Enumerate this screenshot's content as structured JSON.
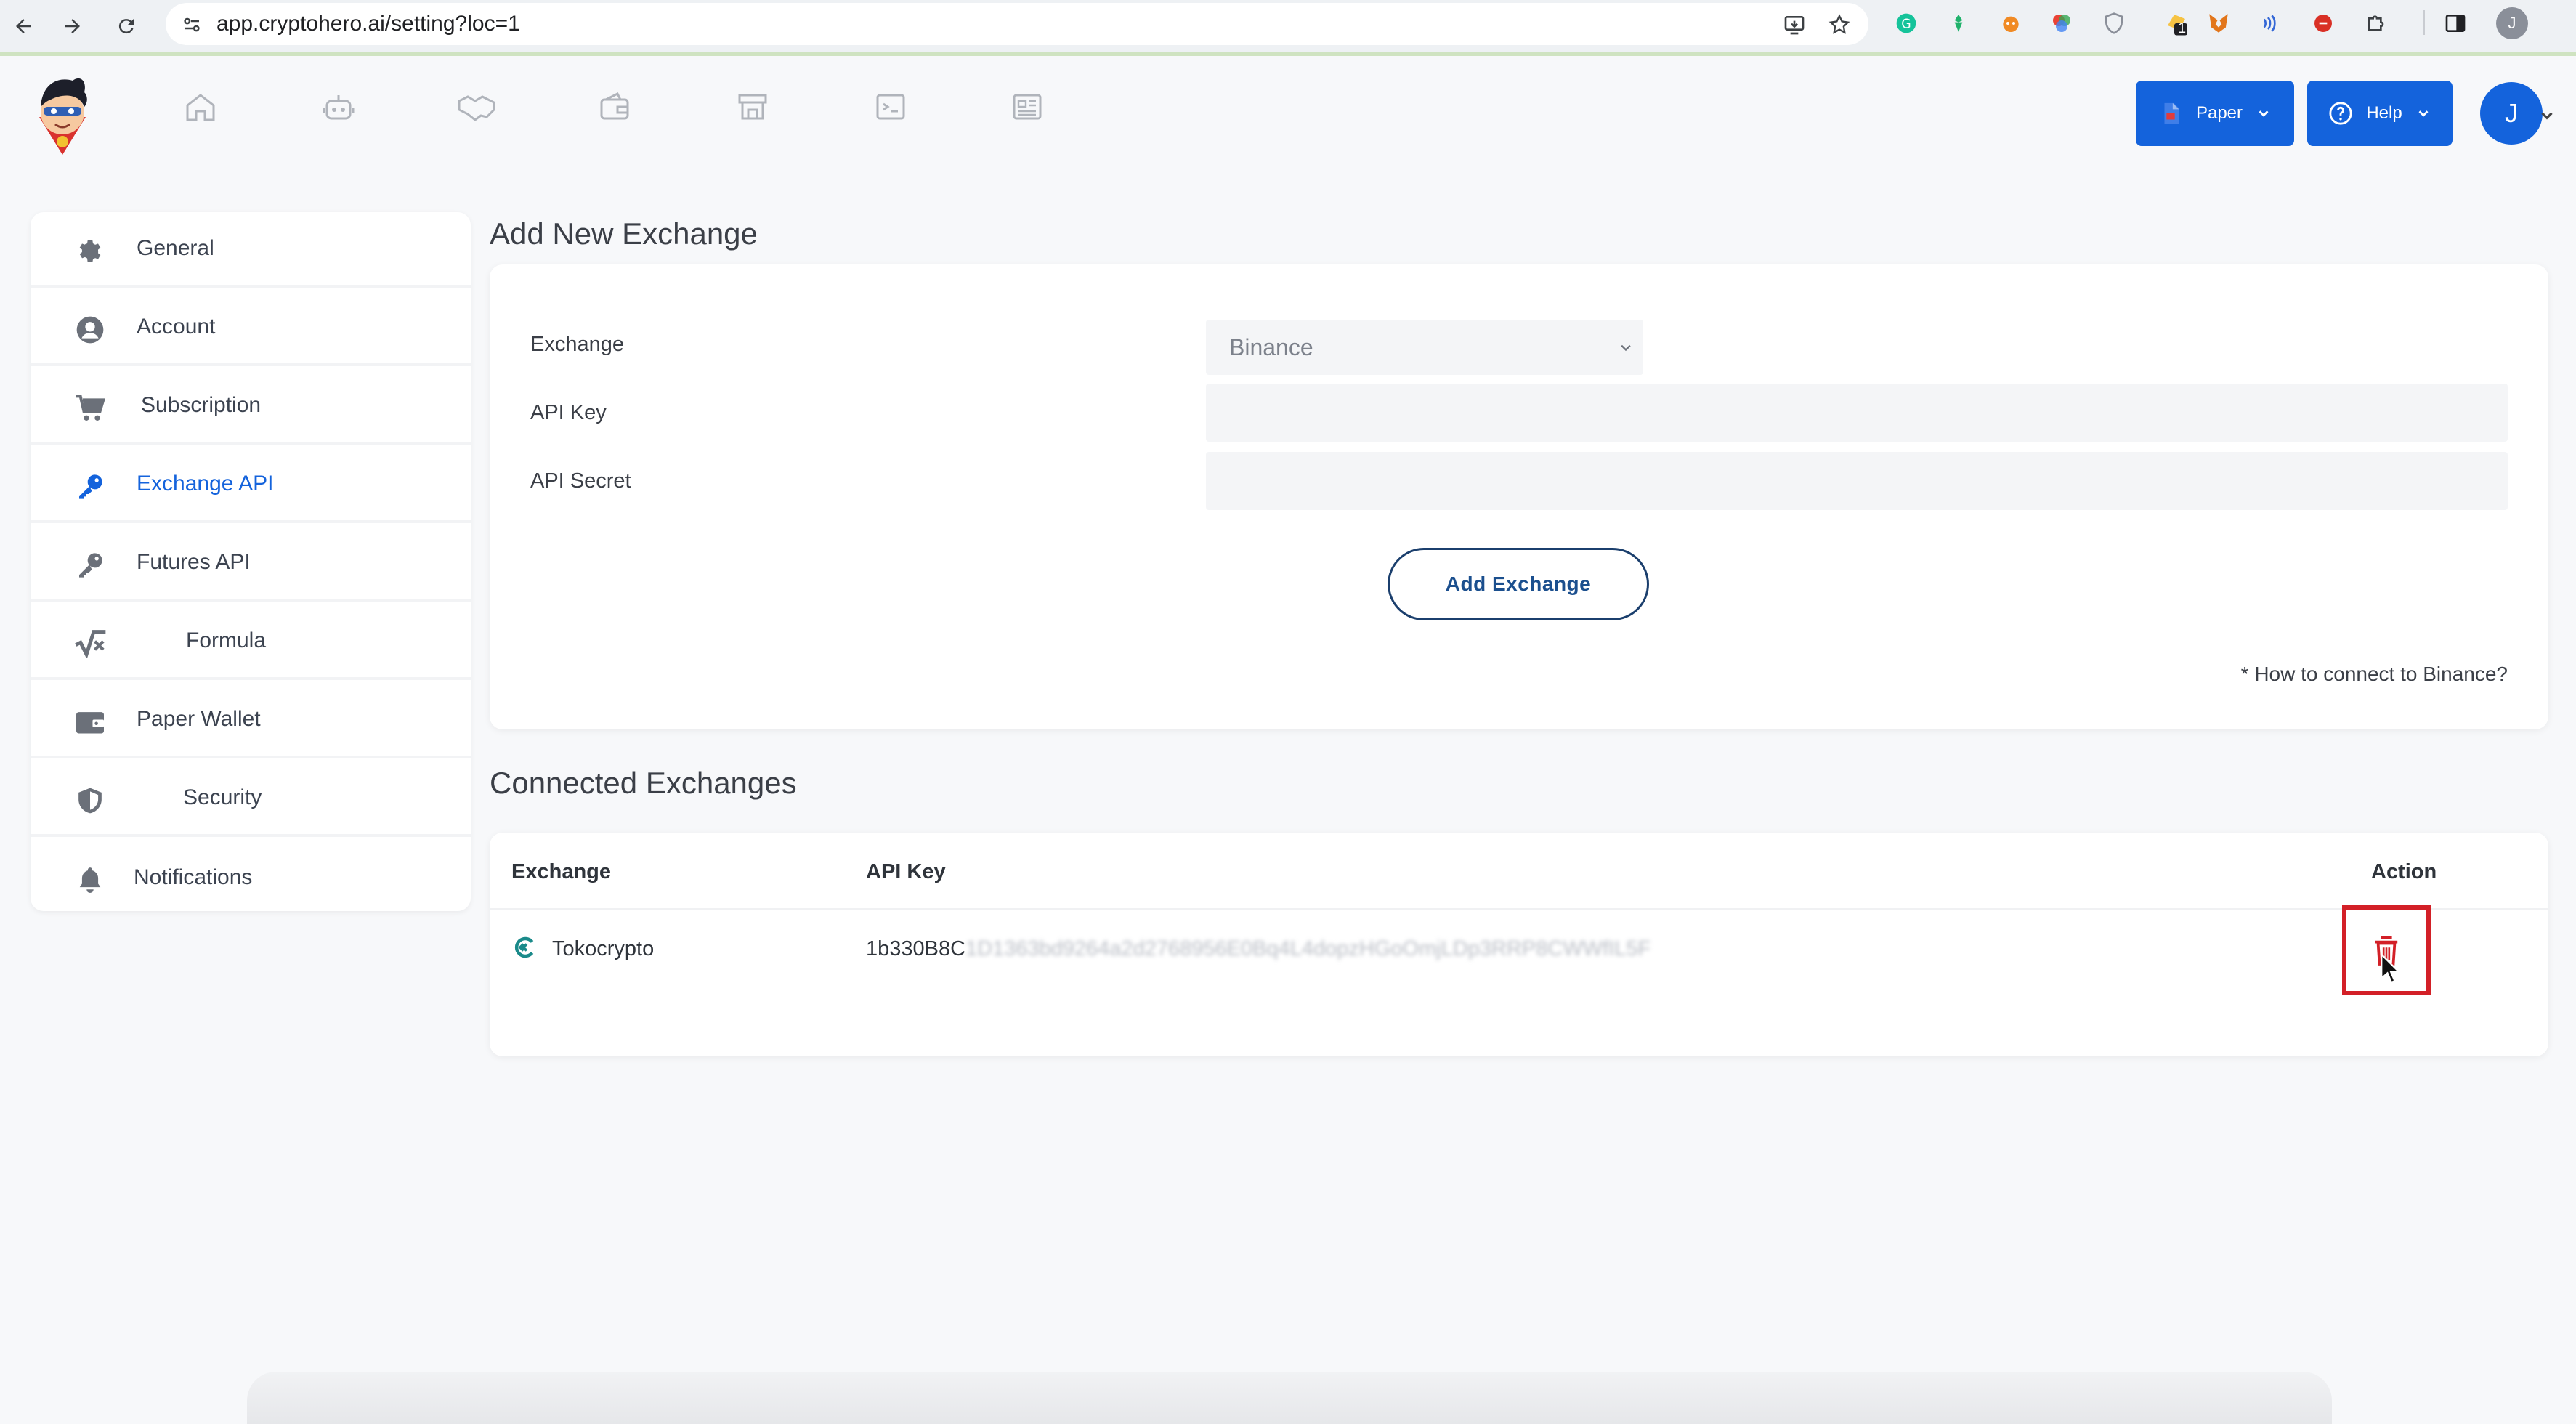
{
  "browser": {
    "url": "app.cryptohero.ai/setting?loc=1",
    "profile_initial": "J",
    "extension_badge": "1"
  },
  "header": {
    "mode_button": "Paper",
    "help_button": "Help",
    "user_initial": "J",
    "accent_color": "#1463dc"
  },
  "sidebar": {
    "items": [
      {
        "label": "General",
        "icon": "gear-icon"
      },
      {
        "label": "Account",
        "icon": "user-circle-icon"
      },
      {
        "label": "Subscription",
        "icon": "cart-icon"
      },
      {
        "label": "Exchange API",
        "icon": "key-icon"
      },
      {
        "label": "Futures API",
        "icon": "key-icon"
      },
      {
        "label": "Formula",
        "icon": "sqrt-icon"
      },
      {
        "label": "Paper Wallet",
        "icon": "wallet-icon"
      },
      {
        "label": "Security",
        "icon": "shield-icon"
      },
      {
        "label": "Notifications",
        "icon": "bell-icon"
      }
    ],
    "active": "Exchange API"
  },
  "add_exchange": {
    "title": "Add New Exchange",
    "exchange_label": "Exchange",
    "exchange_value": "Binance",
    "api_key_label": "API Key",
    "api_key_value": "",
    "api_secret_label": "API Secret",
    "api_secret_value": "",
    "submit_label": "Add Exchange",
    "help_link": "* How to connect to Binance?"
  },
  "connected": {
    "title": "Connected Exchanges",
    "columns": [
      "Exchange",
      "API Key",
      "Action"
    ],
    "rows": [
      {
        "exchange": "Tokocrypto",
        "api_key_visible": "1b330B8C",
        "api_key_hidden": "1D1363bd9264a2d2768956E0Bq4L4dopzHGoOmjLDp3RRP8CWWfIL5F"
      }
    ],
    "delete_color": "#d32027"
  }
}
